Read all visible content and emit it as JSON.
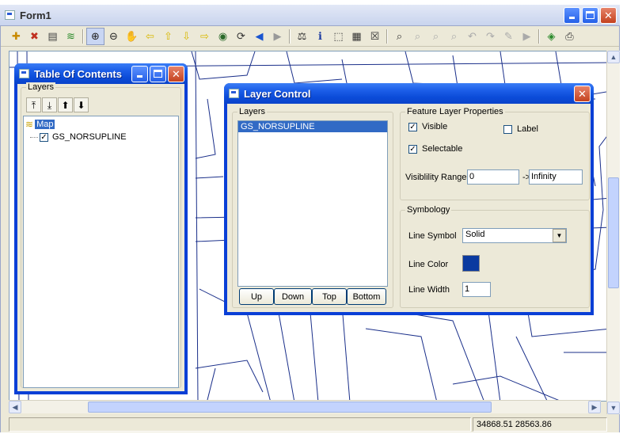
{
  "main_window": {
    "title": "Form1"
  },
  "toolbar": {
    "buttons": [
      {
        "name": "add-layer-icon",
        "glyph": "✚",
        "color": "#c88a00"
      },
      {
        "name": "remove-layer-icon",
        "glyph": "✖",
        "color": "#c03020"
      },
      {
        "name": "properties-icon",
        "glyph": "▤",
        "color": "#444"
      },
      {
        "name": "layers-icon",
        "glyph": "≋",
        "color": "#2a8a2a"
      },
      {
        "name": "zoom-in-icon",
        "glyph": "⊕",
        "color": "#222"
      },
      {
        "name": "zoom-out-icon",
        "glyph": "⊖",
        "color": "#222"
      },
      {
        "name": "pan-icon",
        "glyph": "✋",
        "color": "#222"
      },
      {
        "name": "arrow-left-icon",
        "glyph": "⇦",
        "color": "#d8b800"
      },
      {
        "name": "arrow-up-icon",
        "glyph": "⇧",
        "color": "#d8b800"
      },
      {
        "name": "arrow-down-icon",
        "glyph": "⇩",
        "color": "#d8b800"
      },
      {
        "name": "arrow-right-icon",
        "glyph": "⇨",
        "color": "#d8b800"
      },
      {
        "name": "full-extent-icon",
        "glyph": "◉",
        "color": "#2a6a2a"
      },
      {
        "name": "refresh-icon",
        "glyph": "⟳",
        "color": "#333"
      },
      {
        "name": "back-icon",
        "glyph": "◀",
        "color": "#1a55d0"
      },
      {
        "name": "forward-icon",
        "glyph": "▶",
        "color": "#999"
      },
      {
        "name": "measure-icon",
        "glyph": "⚖",
        "color": "#333"
      },
      {
        "name": "info-icon",
        "glyph": "ℹ",
        "color": "#1a3aa0"
      },
      {
        "name": "select-icon",
        "glyph": "⬚",
        "color": "#333"
      },
      {
        "name": "table-icon",
        "glyph": "▦",
        "color": "#333"
      },
      {
        "name": "clear-select-icon",
        "glyph": "☒",
        "color": "#333"
      },
      {
        "name": "edit-zoom-icon",
        "glyph": "⌕",
        "color": "#333"
      },
      {
        "name": "edit-zoom-2-icon",
        "glyph": "⌕",
        "color": "#aaa"
      },
      {
        "name": "edit-zoom-3-icon",
        "glyph": "⌕",
        "color": "#aaa"
      },
      {
        "name": "edit-zoom-4-icon",
        "glyph": "⌕",
        "color": "#aaa"
      },
      {
        "name": "undo-icon",
        "glyph": "↶",
        "color": "#aaa"
      },
      {
        "name": "redo-icon",
        "glyph": "↷",
        "color": "#aaa"
      },
      {
        "name": "pencil-icon",
        "glyph": "✎",
        "color": "#aaa"
      },
      {
        "name": "play-icon",
        "glyph": "▶",
        "color": "#aaa"
      },
      {
        "name": "export-icon",
        "glyph": "◈",
        "color": "#2a8a2a"
      },
      {
        "name": "print-icon",
        "glyph": "⎙",
        "color": "#333"
      }
    ]
  },
  "toc": {
    "title": "Table Of Contents",
    "group_label": "Layers",
    "tools": [
      {
        "name": "move-top-icon",
        "glyph": "⤒"
      },
      {
        "name": "move-bottom-icon",
        "glyph": "⤓"
      },
      {
        "name": "move-up-icon",
        "glyph": "⬆"
      },
      {
        "name": "move-down-icon",
        "glyph": "⬇"
      }
    ],
    "tree": {
      "root": "Map",
      "layers": [
        {
          "name": "GS_NORSUPLINE",
          "checked": true
        }
      ]
    }
  },
  "layer_control": {
    "title": "Layer Control",
    "layers_label": "Layers",
    "layers": [
      "GS_NORSUPLINE"
    ],
    "buttons": {
      "up": "Up",
      "down": "Down",
      "top": "Top",
      "bottom": "Bottom"
    },
    "feature_props": {
      "label": "Feature Layer Properties",
      "visible": {
        "label": "Visible",
        "checked": true
      },
      "label_chk": {
        "label": "Label",
        "checked": false
      },
      "selectable": {
        "label": "Selectable",
        "checked": true
      },
      "range_label": "Visiblility Range",
      "range_min": "0",
      "arrow": "->",
      "range_max": "Infinity"
    },
    "symbology": {
      "label": "Symbology",
      "line_symbol_label": "Line Symbol",
      "line_symbol_value": "Solid",
      "line_color_label": "Line Color",
      "line_color": "#0a3aa0",
      "line_width_label": "Line Width",
      "line_width_value": "1"
    }
  },
  "status": {
    "coords": "34868.51  28563.86"
  }
}
